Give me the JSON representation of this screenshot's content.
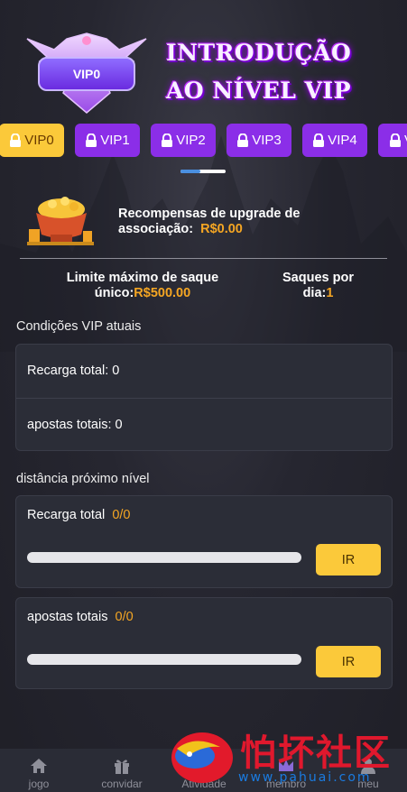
{
  "header": {
    "badge_label": "VIP0",
    "title_line1": "INTRODUÇÃO",
    "title_line2": "AO NÍVEL VIP"
  },
  "tabs": [
    {
      "label": "VIP0",
      "active": true
    },
    {
      "label": "VIP1",
      "active": false
    },
    {
      "label": "VIP2",
      "active": false
    },
    {
      "label": "VIP3",
      "active": false
    },
    {
      "label": "VIP4",
      "active": false
    },
    {
      "label": "V",
      "active": false
    }
  ],
  "reward": {
    "label_line1": "Recompensas de upgrade de",
    "label_line2": "associação:",
    "value": "R$0.00"
  },
  "limits": {
    "withdraw_label_line1": "Limite máximo de saque",
    "withdraw_label_line2": "único:",
    "withdraw_value": "R$500.00",
    "saques_label_line1": "Saques por",
    "saques_label_line2": "dia:",
    "saques_value": "1"
  },
  "current": {
    "title": "Condições VIP atuais",
    "recharge": "Recarga total: 0",
    "bets": "apostas totais: 0"
  },
  "next": {
    "title": "distância próximo nível",
    "recharge_label": "Recarga total",
    "recharge_value": "0/0",
    "recharge_progress": 0,
    "bets_label": "apostas totais",
    "bets_value": "0/0",
    "bets_progress": 0,
    "button_label": "IR"
  },
  "nav": [
    {
      "label": "jogo",
      "icon": "home-icon"
    },
    {
      "label": "convidar",
      "icon": "gift-icon"
    },
    {
      "label": "Atividade",
      "icon": "activity-icon"
    },
    {
      "label": "membro",
      "icon": "crown-icon"
    },
    {
      "label": "meu",
      "icon": "user-icon"
    }
  ],
  "watermark": {
    "text": "怕坏社区",
    "url": "www.pahuai.com"
  },
  "colors": {
    "accent_gold": "#fbc93a",
    "tab_purple": "#8b2ee8",
    "value_orange": "#f5a623"
  }
}
